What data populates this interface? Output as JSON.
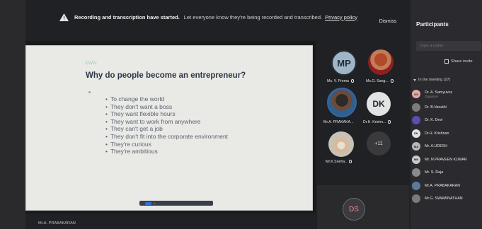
{
  "notification": {
    "title": "Recording and transcription have started.",
    "message": "Let everyone know they're being recorded and transcribed.",
    "link": "Privacy policy",
    "dismiss_label": "Dismiss"
  },
  "slide": {
    "accent": "//////",
    "title": "Why do people become an entrepreneur?",
    "bullets": [
      "To change the world",
      "They don't want a boss",
      "They want flexible hours",
      "They want to work from anywhere",
      "They can't get a job",
      "They don't fit into the corporate environment",
      "They're curious",
      "They're ambitious"
    ]
  },
  "tiles": {
    "t1": {
      "initials": "MP",
      "name": "Ms. V. Prema"
    },
    "t2": {
      "name": "Ms.G. Sang..."
    },
    "t3": {
      "name": "Mr.A. PRAKAKA..."
    },
    "t4": {
      "initials": "DK",
      "name": "Dr.H. Krishn..."
    },
    "t5": {
      "name": "Mr.K.Sneha.."
    },
    "more": "+11",
    "bottom_initials": "DS"
  },
  "presenter": "Mr.A. PRABAKARAN",
  "panel": {
    "title": "Participants",
    "search_placeholder": "Type a name",
    "share_label": "Share invite",
    "section_label": "In the meeting (27)",
    "people": [
      {
        "initials": "DS",
        "name": "Dr. A. Samyuvus",
        "sub": "Organizer",
        "color": "#e7a9a3"
      },
      {
        "initials": "",
        "name": "Dr. B.Vanathi",
        "sub": "",
        "color": "#7c7c7c"
      },
      {
        "initials": "",
        "name": "Dr. K. Devi",
        "sub": "",
        "color": "#5a4fb0"
      },
      {
        "initials": "DK",
        "name": "Dr.H. Krishnan",
        "sub": "",
        "color": "#e2e2e2"
      },
      {
        "initials": "MA",
        "name": "Mr. A.UDESH",
        "sub": "",
        "color": "#b6b6b6"
      },
      {
        "initials": "MN",
        "name": "Mr. N.PRAVEEN KUMAR",
        "sub": "",
        "color": "#c9c9c9"
      },
      {
        "initials": "",
        "name": "Mr. S. Raja",
        "sub": "",
        "color": "#8a8a8a"
      },
      {
        "initials": "",
        "name": "Mr.A. PRABAKARAN",
        "sub": "",
        "color": "#5a7aa0"
      },
      {
        "initials": "",
        "name": "Mr.G. SWAMINATHAN",
        "sub": "",
        "color": "#7a7a7a"
      }
    ]
  },
  "colors": {
    "slide_title": "#2e3748",
    "accent_green": "#69b27a",
    "panel_bg": "#2b2b2f"
  }
}
